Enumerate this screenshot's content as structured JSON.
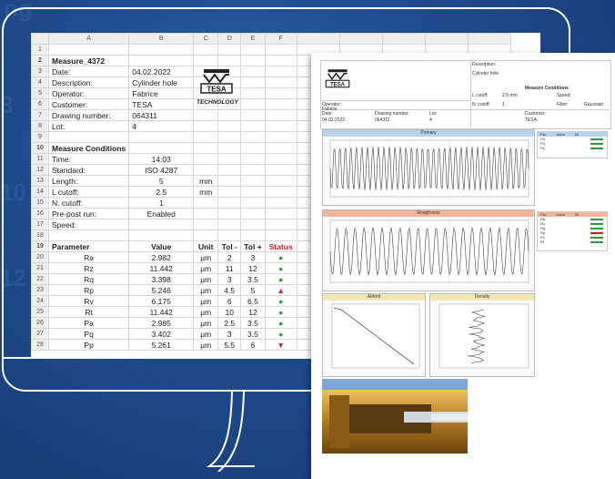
{
  "sheet": {
    "col_headers": [
      "A",
      "B",
      "C",
      "D",
      "E",
      "F"
    ],
    "rows": [
      {
        "n": "1",
        "a": "",
        "b": "",
        "c": "",
        "d": "",
        "e": "",
        "f": ""
      },
      {
        "n": "2",
        "a": "Measure_4372",
        "b": "",
        "c": "",
        "d": "",
        "e": "",
        "f": ""
      },
      {
        "n": "3",
        "a": "Date:",
        "b": "04.02.2022",
        "c": "",
        "d": "",
        "e": "",
        "f": ""
      },
      {
        "n": "4",
        "a": "Description:",
        "b": "Cylinder hole",
        "c": "",
        "d": "",
        "e": "",
        "f": ""
      },
      {
        "n": "5",
        "a": "Operator:",
        "b": "Fabrice",
        "c": "",
        "d": "",
        "e": "",
        "f": ""
      },
      {
        "n": "6",
        "a": "Customer:",
        "b": "TESA",
        "c": "",
        "d": "",
        "e": "",
        "f": ""
      },
      {
        "n": "7",
        "a": "Drawing number:",
        "b": "064311",
        "c": "",
        "d": "",
        "e": "",
        "f": ""
      },
      {
        "n": "8",
        "a": "Lot:",
        "b": "4",
        "c": "",
        "d": "",
        "e": "",
        "f": ""
      },
      {
        "n": "9",
        "a": "",
        "b": "",
        "c": "",
        "d": "",
        "e": "",
        "f": ""
      },
      {
        "n": "10",
        "a": "Measure Conditions",
        "b": "",
        "c": "",
        "d": "",
        "e": "",
        "f": ""
      },
      {
        "n": "11",
        "a": "Time:",
        "b": "14:03",
        "c": "",
        "d": "",
        "e": "",
        "f": ""
      },
      {
        "n": "12",
        "a": "Standard:",
        "b": "ISO 4287",
        "c": "",
        "d": "",
        "e": "",
        "f": ""
      },
      {
        "n": "13",
        "a": "Length:",
        "b": "5",
        "c": "mm",
        "d": "",
        "e": "",
        "f": ""
      },
      {
        "n": "14",
        "a": "L cutoff:",
        "b": "2.5",
        "c": "mm",
        "d": "",
        "e": "",
        "f": ""
      },
      {
        "n": "15",
        "a": "N. cutoff:",
        "b": "1",
        "c": "",
        "d": "",
        "e": "",
        "f": ""
      },
      {
        "n": "16",
        "a": "Pre-post run:",
        "b": "Enabled",
        "c": "",
        "d": "",
        "e": "",
        "f": ""
      },
      {
        "n": "17",
        "a": "Speed:",
        "b": "",
        "c": "",
        "d": "",
        "e": "",
        "f": ""
      },
      {
        "n": "18",
        "a": "",
        "b": "",
        "c": "",
        "d": "",
        "e": "",
        "f": ""
      },
      {
        "n": "19",
        "a": "Parameter",
        "b": "Value",
        "c": "Unit",
        "d": "Tol -",
        "e": "Tol +",
        "f": "Status"
      },
      {
        "n": "20",
        "a": "Ra",
        "b": "2.982",
        "c": "µm",
        "d": "2",
        "e": "3",
        "f": "●"
      },
      {
        "n": "21",
        "a": "Rz",
        "b": "11.442",
        "c": "µm",
        "d": "11",
        "e": "12",
        "f": "●"
      },
      {
        "n": "22",
        "a": "Rq",
        "b": "3.398",
        "c": "µm",
        "d": "3",
        "e": "3.5",
        "f": "●"
      },
      {
        "n": "23",
        "a": "Rp",
        "b": "5.246",
        "c": "µm",
        "d": "4.5",
        "e": "5",
        "f": "▲"
      },
      {
        "n": "24",
        "a": "Rv",
        "b": "6.175",
        "c": "µm",
        "d": "6",
        "e": "6.5",
        "f": "●"
      },
      {
        "n": "25",
        "a": "Rt",
        "b": "11.442",
        "c": "µm",
        "d": "10",
        "e": "12",
        "f": "●"
      },
      {
        "n": "26",
        "a": "Pa",
        "b": "2.985",
        "c": "µm",
        "d": "2.5",
        "e": "3.5",
        "f": "●"
      },
      {
        "n": "27",
        "a": "Pq",
        "b": "3.402",
        "c": "µm",
        "d": "3",
        "e": "3.5",
        "f": "●"
      },
      {
        "n": "28",
        "a": "Pp",
        "b": "5.261",
        "c": "µm",
        "d": "5.5",
        "e": "6",
        "f": "▼"
      }
    ],
    "logo_text": "TESA",
    "logo_sub": "TECHNOLOGY"
  },
  "report": {
    "logo_text": "TESA",
    "description_label": "Description:",
    "description": "Cylinder hole",
    "conditions_title": "Measure Conditions",
    "lcutoff_label": "L cutoff:",
    "lcutoff": "2.5 mm",
    "speed_label": "Speed:",
    "ncutoff_label": "N. cutoff:",
    "ncutoff": "1",
    "filter_label": "Filter:",
    "filter": "Gaussian",
    "operator_label": "Operator:",
    "operator": "Fabrice",
    "date_label": "Date:",
    "date": "04.02.2022",
    "drawing_label": "Drawing number:",
    "drawing": "064311",
    "lot_label": "Lot:",
    "lot": "4",
    "customer_label": "Customer:",
    "customer": "TESA",
    "primary_title": "Primary",
    "roughness_title": "Roughness",
    "abbott_title": "Abbott",
    "density_title": "Density",
    "primary_rows": [
      "Pa",
      "Pq",
      "Pp"
    ],
    "roughness_rows": [
      "Ra",
      "Rz",
      "Rq",
      "Rp",
      "Rv",
      "Rt"
    ],
    "table_head": [
      "Par.",
      "Value",
      "Tol."
    ]
  }
}
